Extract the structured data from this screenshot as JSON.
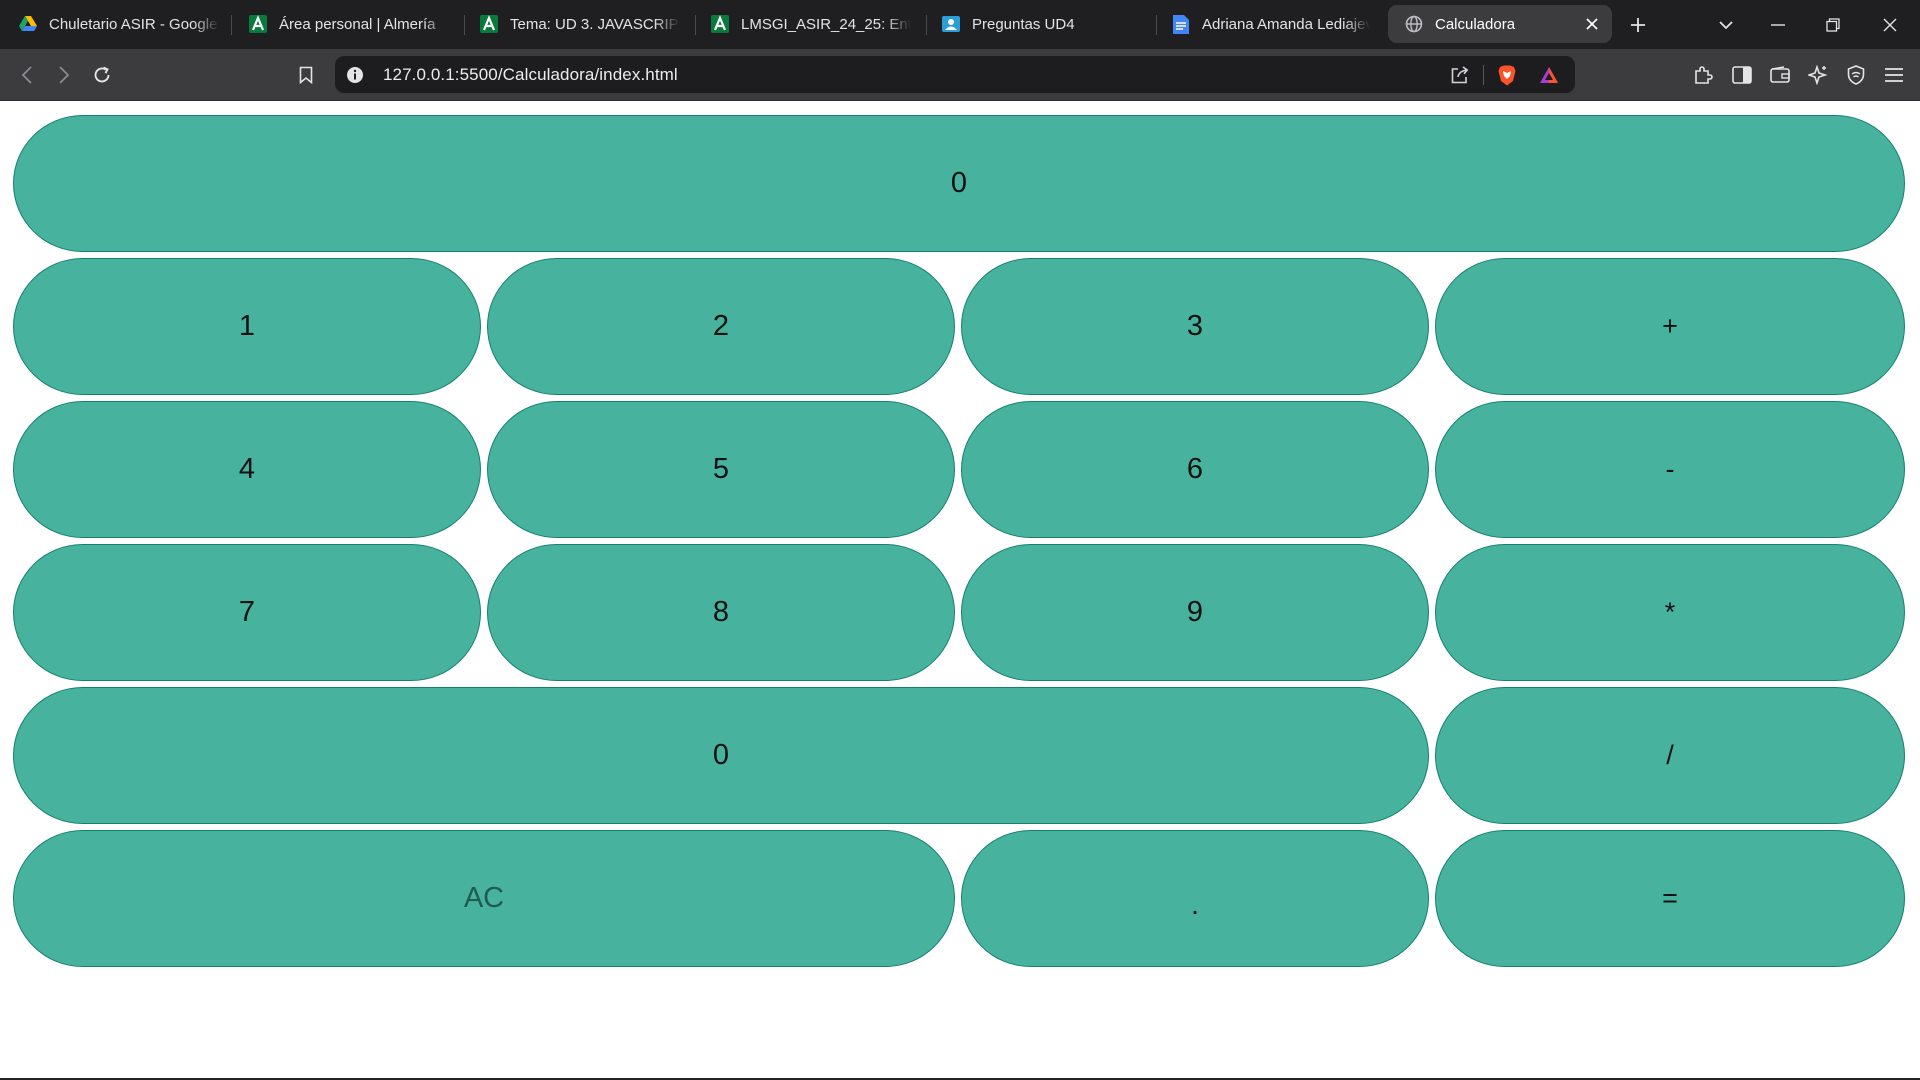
{
  "browser": {
    "tabs": [
      {
        "title": "Chuletario ASIR - Google",
        "icon": "google-drive-icon",
        "active": false
      },
      {
        "title": "Área personal | Almería",
        "icon": "moodle-a-icon",
        "active": false
      },
      {
        "title": "Tema: UD 3. JAVASCRIPT Y",
        "icon": "moodle-a-icon",
        "active": false
      },
      {
        "title": "LMSGI_ASIR_24_25: Entre",
        "icon": "moodle-a-icon",
        "active": false
      },
      {
        "title": "Preguntas UD4",
        "icon": "classroom-icon",
        "active": false
      },
      {
        "title": "Adriana Amanda Lediajev",
        "icon": "google-docs-icon",
        "active": false
      },
      {
        "title": "Calculadora",
        "icon": "globe-icon",
        "active": true
      }
    ],
    "url": "127.0.0.1:5500/Calculadora/index.html"
  },
  "calculator": {
    "display": "0",
    "keys": {
      "one": "1",
      "two": "2",
      "three": "3",
      "plus": "+",
      "four": "4",
      "five": "5",
      "six": "6",
      "minus": "-",
      "seven": "7",
      "eight": "8",
      "nine": "9",
      "multiply": "*",
      "zero": "0",
      "divide": "/",
      "clear": "AC",
      "dot": ".",
      "equals": "="
    },
    "colors": {
      "button_fill": "#47b39e",
      "button_border": "#15806e"
    }
  }
}
